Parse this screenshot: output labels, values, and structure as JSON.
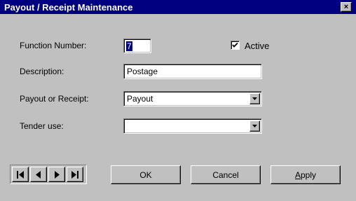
{
  "window": {
    "title": "Payout / Receipt Maintenance",
    "close_glyph": "×"
  },
  "form": {
    "function_number": {
      "label": "Function Number:",
      "value": "7"
    },
    "active": {
      "label": "Active",
      "checked": true
    },
    "description": {
      "label": "Description:",
      "value": "Postage"
    },
    "payout_or_receipt": {
      "label": "Payout or Receipt:",
      "value": "Payout"
    },
    "tender_use": {
      "label": "Tender use:",
      "value": ""
    }
  },
  "buttons": {
    "ok": "OK",
    "cancel": "Cancel",
    "apply_rest": "pply",
    "apply_accel": "A"
  },
  "nav": {
    "icons": [
      "first-record-icon",
      "previous-record-icon",
      "next-record-icon",
      "last-record-icon"
    ]
  },
  "colors": {
    "titlebar": "#000080",
    "face": "#c0c0c0",
    "selection": "#000080"
  }
}
